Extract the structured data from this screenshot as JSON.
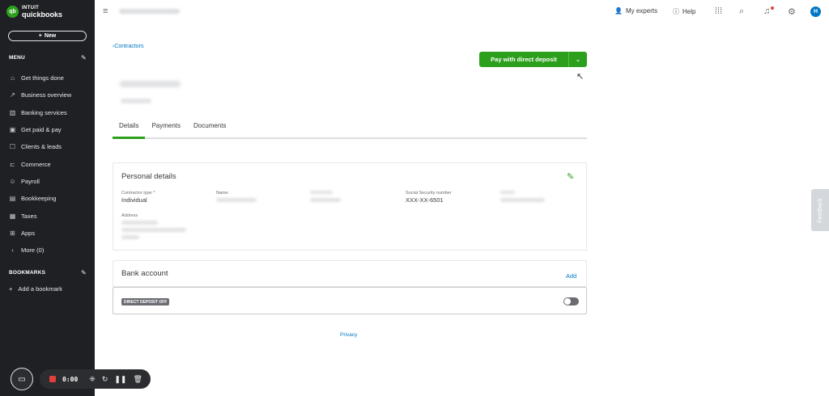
{
  "logo": {
    "line1": "INTUIT",
    "line2": "quickbooks",
    "mark": "qb"
  },
  "sidebar": {
    "new_label": "New",
    "menu_heading": "MENU",
    "items": [
      {
        "label": "Get things done",
        "icon": "home-icon"
      },
      {
        "label": "Business overview",
        "icon": "chart-icon"
      },
      {
        "label": "Banking services",
        "icon": "bank-icon"
      },
      {
        "label": "Get paid & pay",
        "icon": "payment-icon"
      },
      {
        "label": "Clients & leads",
        "icon": "contacts-icon"
      },
      {
        "label": "Commerce",
        "icon": "cart-icon"
      },
      {
        "label": "Payroll",
        "icon": "people-icon"
      },
      {
        "label": "Bookkeeping",
        "icon": "ledger-icon"
      },
      {
        "label": "Taxes",
        "icon": "tax-icon"
      },
      {
        "label": "Apps",
        "icon": "apps-icon"
      },
      {
        "label": "More (0)",
        "icon": "chevron-right-icon"
      }
    ],
    "bookmarks_heading": "BOOKMARKS",
    "add_bookmark": "Add a bookmark"
  },
  "recorder": {
    "time": "0:00"
  },
  "topbar": {
    "my_experts": "My experts",
    "help": "Help",
    "avatar_initial": "H"
  },
  "main": {
    "breadcrumb": "Contractors",
    "pay_button": "Pay with direct deposit",
    "tabs": [
      "Details",
      "Payments",
      "Documents"
    ],
    "personal_details": {
      "title": "Personal details",
      "contractor_type_label": "Contractor type *",
      "contractor_type_value": "Individual",
      "name_label": "Name",
      "ssn_label": "Social Security number",
      "ssn_value": "XXX-XX-6501",
      "address_label": "Address"
    },
    "bank_account": {
      "title": "Bank account",
      "add_label": "Add",
      "direct_deposit_badge": "DIRECT DEPOSIT OFF"
    },
    "privacy": "Privacy",
    "feedback": "Feedback"
  },
  "colors": {
    "brand_green": "#2ca01c",
    "sidebar_bg": "#1f2024",
    "link_blue": "#0077c5"
  }
}
